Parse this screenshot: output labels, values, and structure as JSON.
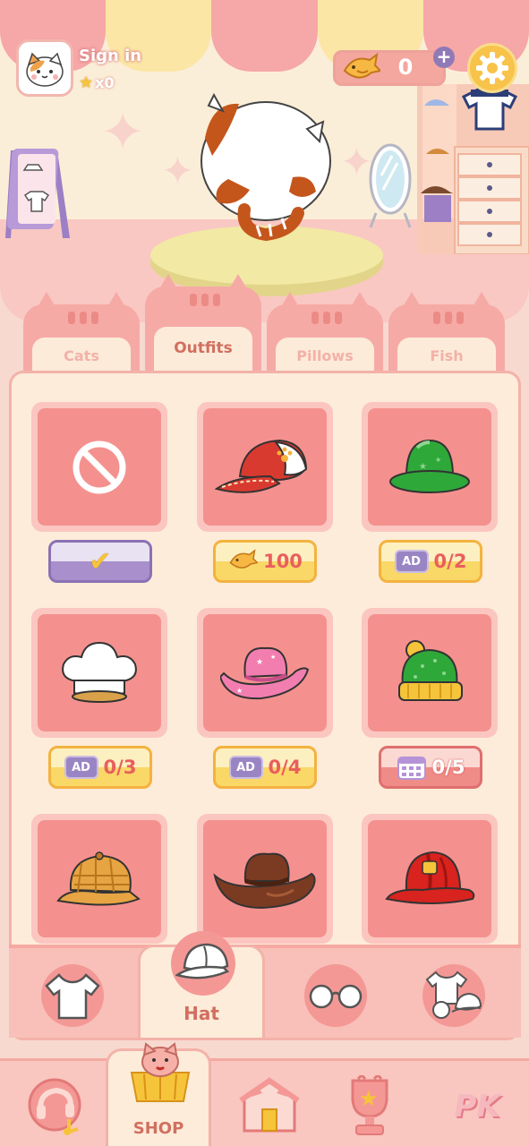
{
  "header": {
    "sign_in_label": "Sign in",
    "star_count": "x0",
    "fish_count": "0"
  },
  "tabs": [
    {
      "label": "Cats",
      "active": false
    },
    {
      "label": "Outfits",
      "active": true
    },
    {
      "label": "Pillows",
      "active": false
    },
    {
      "label": "Fish",
      "active": false
    }
  ],
  "items": [
    {
      "icon": "none-icon",
      "price_type": "owned",
      "price": ""
    },
    {
      "icon": "red-paw-cap-icon",
      "price_type": "fish",
      "price": "100"
    },
    {
      "icon": "green-bowler-hat-icon",
      "price_type": "ad",
      "price": "0/2",
      "ad_label": "AD"
    },
    {
      "icon": "chef-hat-icon",
      "price_type": "ad",
      "price": "0/3",
      "ad_label": "AD"
    },
    {
      "icon": "pink-cowboy-hat-icon",
      "price_type": "ad",
      "price": "0/4",
      "ad_label": "AD"
    },
    {
      "icon": "green-beanie-icon",
      "price_type": "calendar",
      "price": "0/5"
    },
    {
      "icon": "plaid-newsboy-cap-icon"
    },
    {
      "icon": "brown-cowboy-hat-icon"
    },
    {
      "icon": "fire-helmet-icon"
    }
  ],
  "subcategories": {
    "active_label": "Hat",
    "items": [
      "shirt-icon",
      "cap-icon",
      "glasses-icon",
      "outfit-set-icon"
    ]
  },
  "bottom_nav": {
    "shop_label": "SHOP",
    "pk_label": "PK",
    "items": [
      "music-ball-icon",
      "shop-icon",
      "house-icon",
      "trophy-icon",
      "pk-icon"
    ]
  },
  "colors": {
    "panel_bg": "#fcecd9",
    "card_bg": "#f4918e",
    "accent_text": "#d16f60",
    "price_text": "#e95e5e"
  }
}
